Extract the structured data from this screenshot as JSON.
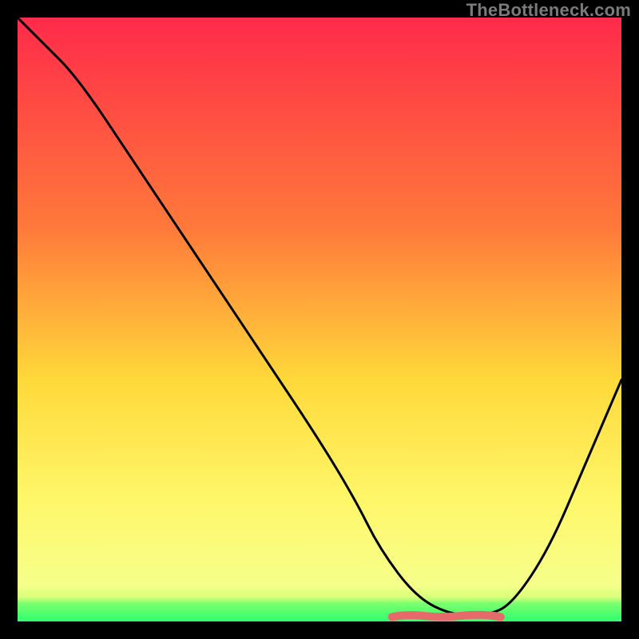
{
  "watermark": "TheBottleneck.com",
  "colors": {
    "frame": "#000000",
    "gradient_top": "#ff2a4a",
    "gradient_mid_upper": "#ff7a3a",
    "gradient_mid": "#ffd93a",
    "gradient_mid_lower": "#fff76a",
    "gradient_bottom_yellow": "#f6ff8a",
    "gradient_green": "#2eff6e",
    "curve": "#000000",
    "highlight": "#e66a6a"
  },
  "chart_data": {
    "type": "line",
    "title": "",
    "xlabel": "",
    "ylabel": "",
    "xlim": [
      0,
      100
    ],
    "ylim": [
      0,
      100
    ],
    "series": [
      {
        "name": "bottleneck-curve",
        "x": [
          0,
          4,
          10,
          20,
          30,
          40,
          50,
          56,
          60,
          66,
          72,
          78,
          82,
          88,
          94,
          100
        ],
        "y": [
          100,
          96,
          90,
          75,
          60,
          45,
          30,
          20,
          12,
          4,
          1,
          1,
          3,
          12,
          26,
          40
        ]
      },
      {
        "name": "optimal-range",
        "x_start": 62,
        "x_end": 80,
        "y": 1
      }
    ],
    "gradient_stops_pct": [
      0,
      35,
      60,
      80,
      94,
      96,
      97,
      100
    ],
    "notes": "No axes, ticks, or numeric labels are rendered in the image; curve values are read relative to the plot area. Gradient runs vertically from red at top through orange and yellow to a thin green band at the bottom."
  }
}
